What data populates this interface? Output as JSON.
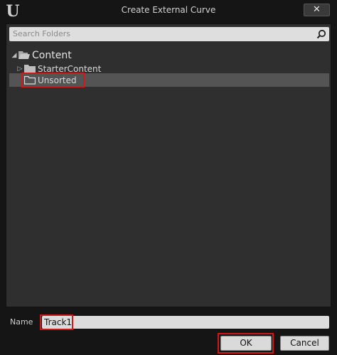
{
  "window": {
    "title": "Create External Curve",
    "logo_text": "U",
    "close_glyph": "✕"
  },
  "search": {
    "placeholder": "Search Folders",
    "value": ""
  },
  "tree": {
    "root": {
      "label": "Content",
      "expanded": true,
      "icon": "folder-open-icon"
    },
    "items": [
      {
        "label": "StarterContent",
        "has_children": true,
        "icon": "folder-icon"
      },
      {
        "label": "Unsorted",
        "has_children": false,
        "selected": true,
        "icon": "folder-icon"
      }
    ]
  },
  "name_field": {
    "label": "Name",
    "value": "Track1"
  },
  "buttons": {
    "ok": "OK",
    "cancel": "Cancel"
  },
  "colors": {
    "background": "#151515",
    "panel": "#2f2f2f",
    "selection": "#545454",
    "highlight": "#d01818"
  }
}
